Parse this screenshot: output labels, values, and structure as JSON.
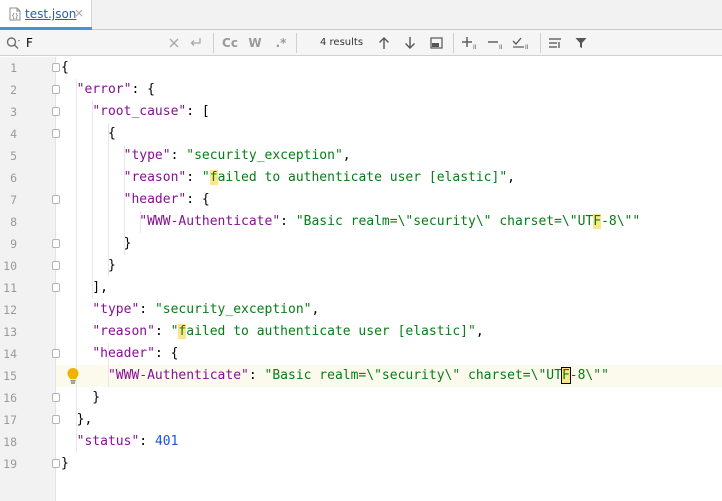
{
  "tab": {
    "label": "test.json",
    "close": "×",
    "icon": "json-file-icon"
  },
  "search": {
    "value": "F",
    "results": "4 results",
    "cc_label": "Cc",
    "w_label": "W",
    "regex_label": ".*"
  },
  "editor": {
    "line_numbers": [
      "1",
      "2",
      "3",
      "4",
      "5",
      "6",
      "7",
      "8",
      "9",
      "10",
      "11",
      "12",
      "13",
      "14",
      "15",
      "16",
      "17",
      "18",
      "19"
    ],
    "code": {
      "error_key": "\"error\"",
      "root_cause_key": "\"root_cause\"",
      "type_key": "\"type\"",
      "type_value": "\"security_exception\"",
      "reason_key": "\"reason\"",
      "reason_value_open": "\"",
      "reason_value_match": "f",
      "reason_value_rest": "ailed to authenticate user [elastic]\"",
      "header_key": "\"header\"",
      "www_key": "\"WWW-Authenticate\"",
      "www_value_pre": "\"Basic realm=\\\"security\\\" charset=\\\"UT",
      "www_value_match": "F",
      "www_value_post": "-8\\\"\"",
      "status_key": "\"status\"",
      "status_value": "401"
    }
  },
  "colors": {
    "key": "#871094",
    "string": "#067d17",
    "number": "#1750eb",
    "match": "#fde68a",
    "current_line": "#fcfaed"
  }
}
